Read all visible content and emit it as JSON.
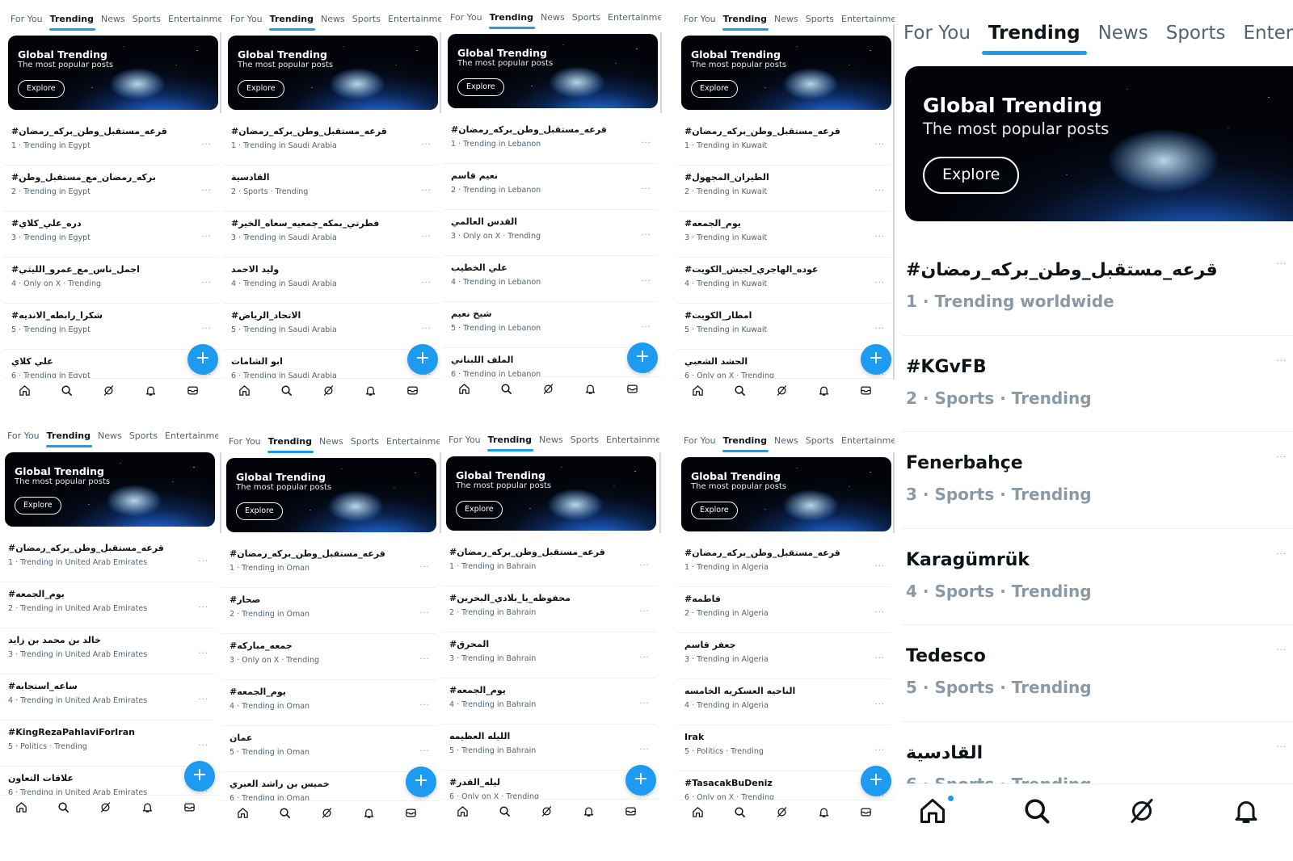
{
  "tabs": [
    "For You",
    "Trending",
    "News",
    "Sports",
    "Entertainment"
  ],
  "banner": {
    "title": "Global Trending",
    "subtitle": "The most popular posts",
    "button": "Explore"
  },
  "more_icon": "···",
  "fab_icon": "+",
  "nav_icons": [
    "home-icon",
    "search-icon",
    "grok-icon",
    "bell-icon",
    "mail-icon"
  ],
  "accent": "#1d9bf0",
  "panels": [
    {
      "trends": [
        {
          "name": "#قرعه_مستقبل_وطن_بركه_رمضان",
          "meta": "1 · Trending in Egypt"
        },
        {
          "name": "#بركه_رمضان_مع_مستقبل_وطن",
          "meta": "2 · Trending in Egypt"
        },
        {
          "name": "#دره_علي_كلاي",
          "meta": "3 · Trending in Egypt"
        },
        {
          "name": "#اجمل_ناس_مع_عمرو_الليثي",
          "meta": "4 · Only on X · Trending"
        },
        {
          "name": "#شكرا_رابطه_الانديه",
          "meta": "5 · Trending in Egypt"
        },
        {
          "name": "علي كلاي",
          "meta": "6 · Trending in Egypt"
        }
      ]
    },
    {
      "trends": [
        {
          "name": "#قرعه_مستقبل_وطن_بركه_رمضان",
          "meta": "1 · Trending in Saudi Arabia"
        },
        {
          "name": "القادسية",
          "meta": "2 · Sports · Trending"
        },
        {
          "name": "#فطرتي_بمكه_جمعيه_سعاه_الخير",
          "meta": "3 · Trending in Saudi Arabia"
        },
        {
          "name": "وليد الاحمد",
          "meta": "4 · Trending in Saudi Arabia"
        },
        {
          "name": "#الاتحاد_الرياض",
          "meta": "5 · Trending in Saudi Arabia"
        },
        {
          "name": "ابو الشامات",
          "meta": "6 · Trending in Saudi Arabia"
        }
      ]
    },
    {
      "trends": [
        {
          "name": "#قرعه_مستقبل_وطن_بركه_رمضان",
          "meta": "1 · Trending in Lebanon"
        },
        {
          "name": "نعيم قاسم",
          "meta": "2 · Trending in Lebanon"
        },
        {
          "name": "القدس العالمي",
          "meta": "3 · Only on X · Trending"
        },
        {
          "name": "علي الخطيب",
          "meta": "4 · Trending in Lebanon"
        },
        {
          "name": "شيخ نعيم",
          "meta": "5 · Trending in Lebanon"
        },
        {
          "name": "الملف اللبناني",
          "meta": "6 · Trending in Lebanon"
        }
      ]
    },
    {
      "trends": [
        {
          "name": "#قرعه_مستقبل_وطن_بركه_رمضان",
          "meta": "1 · Trending in Kuwait"
        },
        {
          "name": "#الطيران_المجهول",
          "meta": "2 · Trending in Kuwait"
        },
        {
          "name": "#يوم_الجمعه",
          "meta": "3 · Trending in Kuwait"
        },
        {
          "name": "#عوده_الهاجري_لجيش_الكويت",
          "meta": "4 · Trending in Kuwait"
        },
        {
          "name": "#امطار_الكويت",
          "meta": "5 · Trending in Kuwait"
        },
        {
          "name": "الحشد الشعبي",
          "meta": "6 · Only on X · Trending"
        }
      ]
    },
    {
      "trends": [
        {
          "name": "#قرعه_مستقبل_وطن_بركه_رمضان",
          "meta": "1 · Trending in United Arab Emirates"
        },
        {
          "name": "#يوم_الجمعه",
          "meta": "2 · Trending in United Arab Emirates"
        },
        {
          "name": "خالد بن محمد بن زايد",
          "meta": "3 · Trending in United Arab Emirates"
        },
        {
          "name": "#ساعه_استجابه",
          "meta": "4 · Trending in United Arab Emirates"
        },
        {
          "name": "#KingRezaPahlaviForIran",
          "meta": "5 · Politics · Trending"
        },
        {
          "name": "علاقات التعاون",
          "meta": "6 · Trending in United Arab Emirates"
        }
      ]
    },
    {
      "trends": [
        {
          "name": "#قرعه_مستقبل_وطن_بركه_رمضان",
          "meta": "1 · Trending in Oman"
        },
        {
          "name": "#صحار",
          "meta": "2 · Trending in Oman"
        },
        {
          "name": "#جمعه_مباركه",
          "meta": "3 · Only on X · Trending"
        },
        {
          "name": "#يوم_الجمعه",
          "meta": "4 · Trending in Oman"
        },
        {
          "name": "عمان",
          "meta": "5 · Trending in Oman"
        },
        {
          "name": "خميس بن راشد العبري",
          "meta": "6 · Trending in Oman"
        }
      ]
    },
    {
      "trends": [
        {
          "name": "#قرعه_مستقبل_وطن_بركه_رمضان",
          "meta": "1 · Trending in Bahrain"
        },
        {
          "name": "#محفوظه_يا_بلادي_البحرين",
          "meta": "2 · Trending in Bahrain"
        },
        {
          "name": "#المحرق",
          "meta": "3 · Trending in Bahrain"
        },
        {
          "name": "#يوم_الجمعه",
          "meta": "4 · Trending in Bahrain"
        },
        {
          "name": "الليله العظيمه",
          "meta": "5 · Trending in Bahrain"
        },
        {
          "name": "#ليله_القدر",
          "meta": "6 · Only on X · Trending"
        }
      ]
    },
    {
      "trends": [
        {
          "name": "#قرعه_مستقبل_وطن_بركه_رمضان",
          "meta": "1 · Trending in Algeria"
        },
        {
          "name": "#فاطمه",
          "meta": "2 · Trending in Algeria"
        },
        {
          "name": "جعفر قاسم",
          "meta": "3 · Trending in Algeria"
        },
        {
          "name": "الناحيه العسكريه الخامسه",
          "meta": "4 · Trending in Algeria"
        },
        {
          "name": "Irak",
          "meta": "5 · Politics · Trending"
        },
        {
          "name": "#TasacakBuDeniz",
          "meta": "6 · Only on X · Trending"
        }
      ]
    }
  ],
  "big_panel": {
    "tabs": [
      "For You",
      "Trending",
      "News",
      "Sports",
      "Enter"
    ],
    "trends": [
      {
        "name": "#قرعه_مستقبل_وطن_بركه_رمضان",
        "meta": "1 · Trending worldwide"
      },
      {
        "name": "#KGvFB",
        "meta": "2 · Sports · Trending"
      },
      {
        "name": "Fenerbahçe",
        "meta": "3 · Sports · Trending"
      },
      {
        "name": "Karagümrük",
        "meta": "4 · Sports · Trending"
      },
      {
        "name": "Tedesco",
        "meta": "5 · Sports · Trending"
      },
      {
        "name": "القادسية",
        "meta": "6 · Sports · Trending"
      }
    ],
    "nav_icons": [
      "home-icon",
      "search-icon",
      "grok-icon",
      "bell-icon"
    ]
  }
}
